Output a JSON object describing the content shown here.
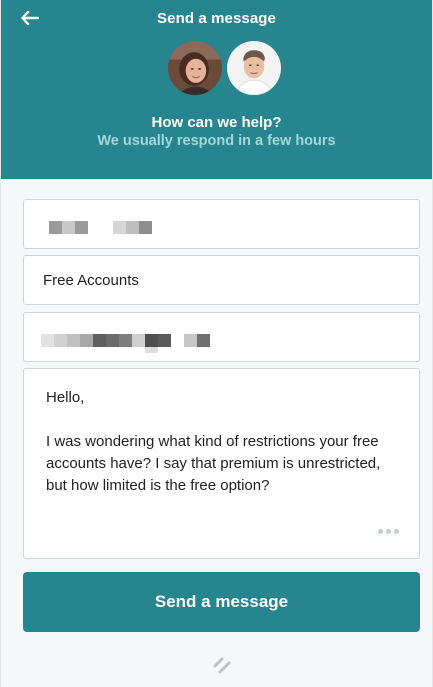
{
  "header": {
    "title": "Send a message",
    "help_title": "How can we help?",
    "help_subtitle": "We usually respond in a few hours",
    "back_icon": "arrow-left-icon",
    "background_color": "#26858f"
  },
  "form": {
    "subject_value": "Free Accounts",
    "message_value": "Hello,\n\nI was wondering what kind of restrictions your free accounts have? I say that premium is unrestricted, but how limited is the free option?",
    "more_icon": "ellipsis-icon"
  },
  "actions": {
    "send_label": "Send a message"
  },
  "footer": {
    "brand_icon": "brand-slashes-icon"
  }
}
